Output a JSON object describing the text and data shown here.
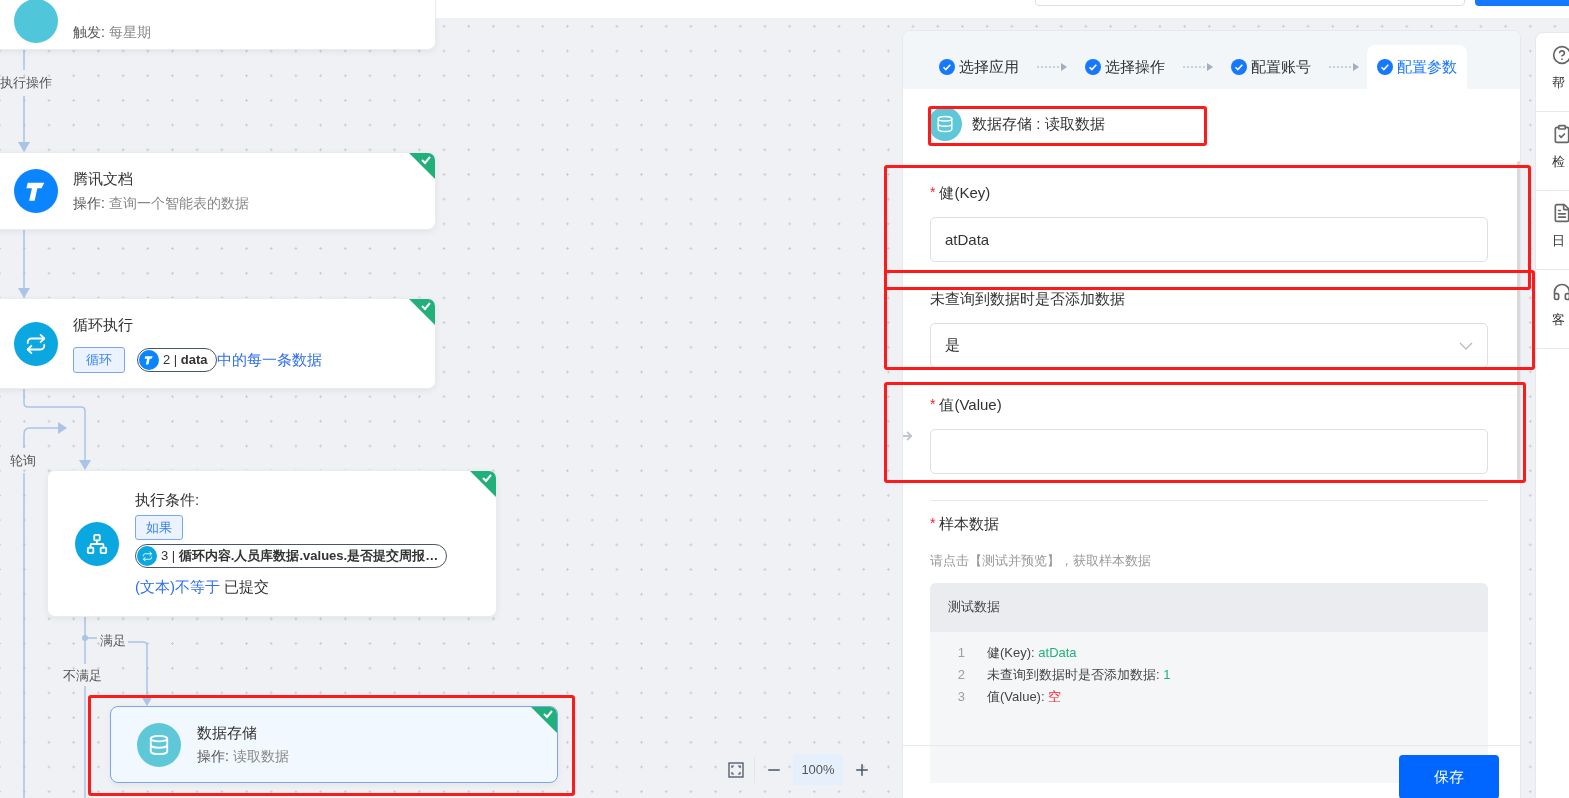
{
  "canvas": {
    "nodes": [
      {
        "kind": "trigger",
        "selected": false,
        "op_label": "触发:",
        "op_value": "每星期"
      },
      {
        "kind": "app",
        "done": true,
        "selected": false,
        "title": "腾讯文档",
        "op_label": "操作:",
        "op_value": "查询一个智能表的数据"
      },
      {
        "kind": "loop",
        "done": true,
        "selected": false,
        "title": "循环执行",
        "tag": "循环",
        "ref": "2 | **data**",
        "suffix": "中的每一条数据"
      },
      {
        "kind": "condition",
        "done": true,
        "selected": false,
        "title": "执行条件:",
        "tag": "如果",
        "ref": "3 | **循环内容.人员库数据.values.是否提交周报…**",
        "operator": "(文本)不等于",
        "value": "已提交"
      },
      {
        "kind": "storage",
        "done": true,
        "selected": true,
        "title": "数据存储",
        "op_label": "操作:",
        "op_value": "读取数据"
      }
    ],
    "edge_labels": [
      "执行操作",
      "轮询",
      "满足",
      "不满足"
    ],
    "zoom_text": "100%"
  },
  "panel": {
    "steps": [
      {
        "label": "选择应用",
        "selected": false
      },
      {
        "label": "选择操作",
        "selected": false
      },
      {
        "label": "配置账号",
        "selected": false
      },
      {
        "label": "配置参数",
        "selected": true
      }
    ],
    "header": {
      "app": "数据存储",
      "separator": ":",
      "action": "读取数据"
    },
    "fields": [
      {
        "kind": "input",
        "label": "健(Key)",
        "required_mark": "*",
        "value": "atData"
      },
      {
        "kind": "select",
        "label": "未查询到数据时是否添加数据",
        "value": "是"
      },
      {
        "kind": "input",
        "label": "值(Value)",
        "required_mark": "*"
      }
    ],
    "sample": {
      "label": "样本数据",
      "required_mark": "*",
      "hint": "请点击【测试并预览】，获取样本数据",
      "title": "测试数据",
      "lines": [
        {
          "number": "1",
          "key": "健(Key):",
          "value": "atData",
          "empty": false
        },
        {
          "number": "2",
          "key": "未查询到数据时是否添加数据:",
          "value": "1",
          "empty": false
        },
        {
          "number": "3",
          "key": "值(Value):",
          "value": "空",
          "empty": true
        }
      ]
    },
    "save": "保存"
  },
  "side_strip": [
    "帮",
    "检",
    "日",
    "客"
  ]
}
